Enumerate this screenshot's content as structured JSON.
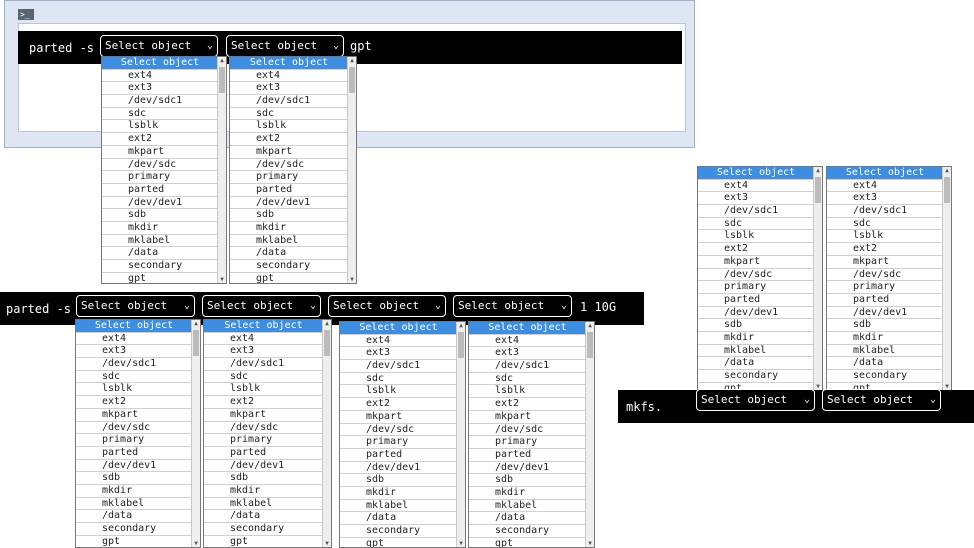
{
  "options": [
    "Select object",
    "ext4",
    "ext3",
    "/dev/sdc1",
    "sdc",
    "lsblk",
    "ext2",
    "mkpart",
    "/dev/sdc",
    "primary",
    "parted",
    "/dev/dev1",
    "sdb",
    "mkdir",
    "mklabel",
    "/data",
    "secondary",
    "gpt"
  ],
  "window": {
    "icon_label": ">_"
  },
  "row1": {
    "prefix": "parted -s",
    "suffix": "gpt",
    "select1": "Select object",
    "select2": "Select object"
  },
  "row2": {
    "prefix": "parted -s",
    "suffix": "1 10G",
    "select1": "Select object",
    "select2": "Select object",
    "select3": "Select object",
    "select4": "Select object"
  },
  "row3": {
    "prefix": "mkfs.",
    "select1": "Select object",
    "select2": "Select object"
  },
  "chevron": "⌄"
}
